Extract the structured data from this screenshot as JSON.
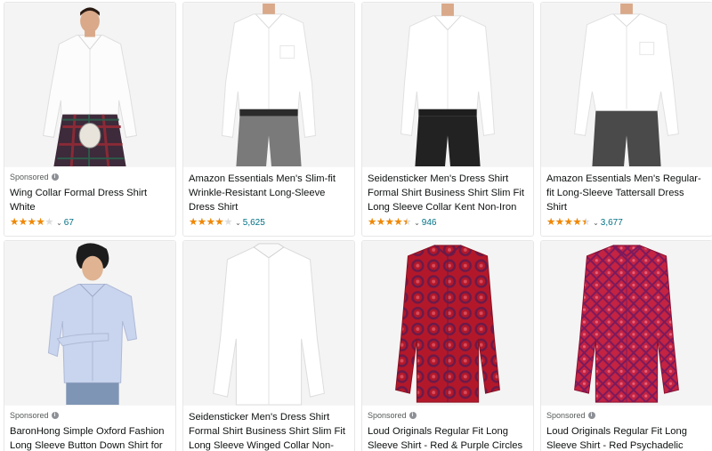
{
  "colors": {
    "star": "#f08804",
    "link": "#007185",
    "text": "#0f1111",
    "muted": "#565959"
  },
  "products": [
    {
      "sponsored": "Sponsored",
      "title": "Wing Collar Formal Dress Shirt White",
      "rating": 4.0,
      "count": "67"
    },
    {
      "sponsored": "",
      "title": "Amazon Essentials Men's Slim-fit Wrinkle-Resistant Long-Sleeve Dress Shirt",
      "rating": 4.0,
      "count": "5,625"
    },
    {
      "sponsored": "",
      "title": "Seidensticker Men's Dress Shirt Formal Shirt Business Shirt Slim Fit Long Sleeve Collar Kent Non-Iron",
      "rating": 4.5,
      "count": "946"
    },
    {
      "sponsored": "",
      "title": "Amazon Essentials Men's Regular-fit Long-Sleeve Tattersall Dress Shirt",
      "rating": 4.5,
      "count": "3,677"
    },
    {
      "sponsored": "Sponsored",
      "title": "BaronHong Simple Oxford Fashion Long Sleeve Button Down Shirt for",
      "rating": null,
      "count": ""
    },
    {
      "sponsored": "",
      "title": "Seidensticker Men's Dress Shirt Formal Shirt Business Shirt Slim Fit Long Sleeve Winged Collar Non-Iron",
      "rating": null,
      "count": ""
    },
    {
      "sponsored": "Sponsored",
      "title": "Loud Originals Regular Fit Long Sleeve Shirt - Red & Purple Circles",
      "rating": null,
      "count": ""
    },
    {
      "sponsored": "Sponsored",
      "title": "Loud Originals Regular Fit Long Sleeve Shirt - Red Psychadelic Tribal",
      "rating": null,
      "count": ""
    }
  ]
}
